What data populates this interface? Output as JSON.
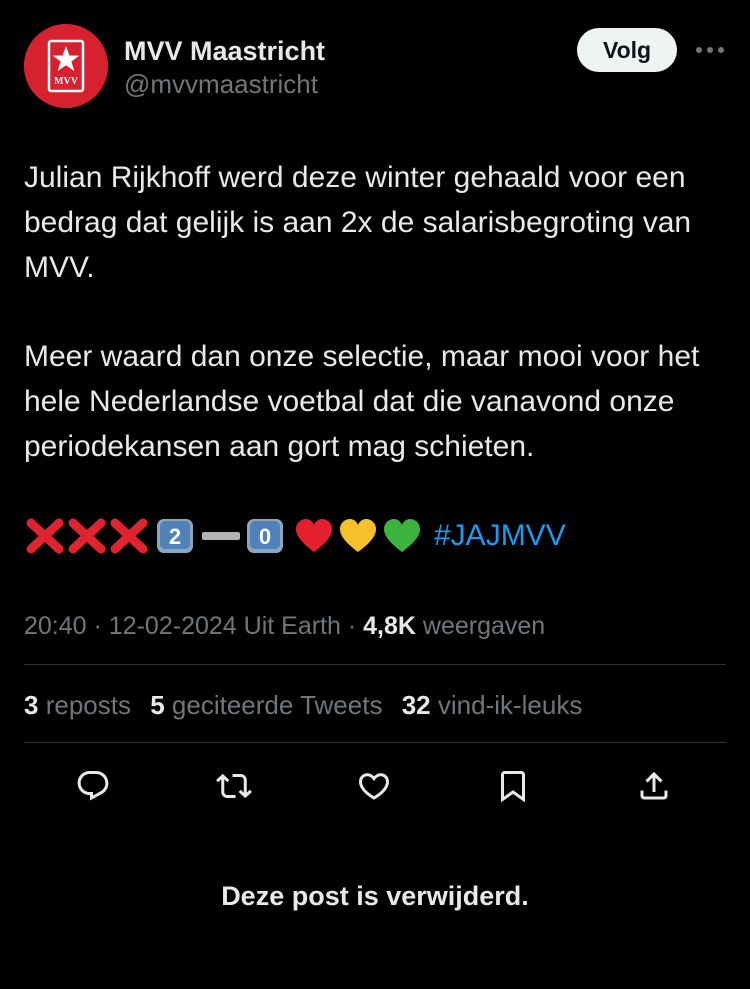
{
  "account": {
    "display_name": "MVV Maastricht",
    "handle": "@mvvmaastricht",
    "avatar_text": "MVV",
    "avatar_color": "#d7212f"
  },
  "header": {
    "follow_label": "Volg",
    "more_icon": "more-horizontal-icon"
  },
  "tweet": {
    "paragraph_1": "Julian Rijkhoff werd deze winter gehaald voor een bedrag dat gelijk is aan 2x de salarisbegroting van MVV.",
    "paragraph_2": "Meer waard dan onze selectie, maar mooi voor het hele Nederlandse voetbal dat die vanavond onze periodekansen aan gort mag schieten.",
    "emoji_line": {
      "cross_marks": [
        "❌",
        "❌",
        "❌"
      ],
      "score_home": "2",
      "score_dash": "➖",
      "score_away": "0",
      "hearts": [
        "❤️",
        "💛",
        "💚"
      ],
      "hashtag": "#JAJMVV"
    }
  },
  "meta": {
    "time": "20:40",
    "date": "12-02-2024",
    "location": "Uit Earth",
    "views_count": "4,8K",
    "views_label": "weergaven",
    "separator": "·"
  },
  "stats": {
    "reposts_count": "3",
    "reposts_label": "reposts",
    "quotes_count": "5",
    "quotes_label": "geciteerde Tweets",
    "likes_count": "32",
    "likes_label": "vind-ik-leuks"
  },
  "actions": {
    "reply_icon": "reply-icon",
    "repost_icon": "repost-icon",
    "like_icon": "heart-icon",
    "bookmark_icon": "bookmark-icon",
    "share_icon": "share-icon"
  },
  "notice": {
    "text": "Deze post is verwijderd."
  },
  "colors": {
    "background": "#000000",
    "text": "#e7e9ea",
    "muted": "#71767b",
    "link": "#1d9bf0",
    "divider": "#2f3336"
  }
}
